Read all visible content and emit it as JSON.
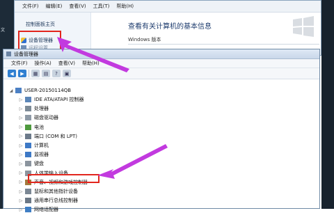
{
  "desktop": {
    "left_fragments": [
      "文"
    ]
  },
  "control_panel": {
    "menu": [
      "文件(F)",
      "编辑(E)",
      "查看(V)",
      "工具(T)",
      "帮助(H)"
    ],
    "sidebar": {
      "home": "控制面板主页",
      "device_manager_link": "设备管理器",
      "remote_settings_link": "远程设置"
    },
    "main_title": "查看有关计算机的基本信息",
    "windows_edition": "Windows 版本"
  },
  "device_manager": {
    "title": "设备管理器",
    "menu": [
      "文件(F)",
      "操作(A)",
      "查看(V)",
      "帮助(H)"
    ],
    "tree": {
      "root": "USER-20150114QB",
      "items": [
        {
          "label": "IDE ATA/ATAPI 控制器",
          "icon": "ide-controller-icon",
          "color": "#5b86b8"
        },
        {
          "label": "处理器",
          "icon": "processor-icon",
          "color": "#7c8a96"
        },
        {
          "label": "磁盘驱动器",
          "icon": "disk-drive-icon",
          "color": "#8e9aa6"
        },
        {
          "label": "电池",
          "icon": "battery-icon",
          "color": "#4f9a3f"
        },
        {
          "label": "端口 (COM 和 LPT)",
          "icon": "port-icon",
          "color": "#6c7a8a"
        },
        {
          "label": "计算机",
          "icon": "computer-icon",
          "color": "#3e79c6"
        },
        {
          "label": "监视器",
          "icon": "monitor-icon",
          "color": "#3e79c6"
        },
        {
          "label": "键盘",
          "icon": "keyboard-icon",
          "color": "#8b949e"
        },
        {
          "label": "人体学输入设备",
          "icon": "hid-icon",
          "color": "#8b949e"
        },
        {
          "label": "声音、视频和游戏控制器",
          "icon": "sound-icon",
          "color": "#a27a3c"
        },
        {
          "label": "鼠标和其他指针设备",
          "icon": "mouse-icon",
          "color": "#7b8794"
        },
        {
          "label": "通用串行总线控制器",
          "icon": "usb-icon",
          "color": "#6b7785"
        },
        {
          "label": "网络适配器",
          "icon": "network-adapter-icon",
          "color": "#3f7ec4"
        }
      ]
    }
  },
  "annotation_color": "#c23adf",
  "highlight_color": "#e2261d"
}
